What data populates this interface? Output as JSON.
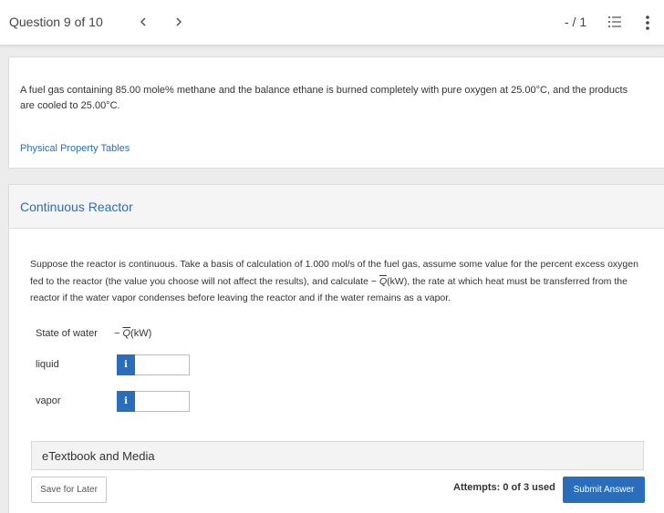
{
  "header": {
    "question_label": "Question 9 of 10",
    "prev_glyph": "<",
    "next_glyph": ">",
    "score": "- / 1"
  },
  "problem": {
    "text": "A fuel gas containing 85.00 mole% methane and the balance ethane is burned completely with pure oxygen at 25.00°C, and the products are cooled to 25.00°C.",
    "link_label": "Physical Property Tables"
  },
  "section": {
    "title": "Continuous Reactor",
    "prompt_before": "Suppose the reactor is continuous. Take a basis of calculation of 1.000 mol/s of the fuel gas, assume some value for the percent excess oxygen fed to the reactor (the value you choose will not affect the results), and calculate − ",
    "prompt_q": "Q",
    "prompt_after": "(kW), the rate at which heat must be transferred from the reactor if the water vapor condenses before leaving the reactor and if the water remains as a vapor."
  },
  "table": {
    "col_state": "State of water",
    "col_q_prefix": "− ",
    "col_q_symbol": "Q",
    "col_q_suffix": "(kW)",
    "rows": [
      {
        "label": "liquid",
        "value": ""
      },
      {
        "label": "vapor",
        "value": ""
      }
    ],
    "info_glyph": "i"
  },
  "media": {
    "label": "eTextbook and Media"
  },
  "footer": {
    "save_label": "Save for Later",
    "attempts": "Attempts: 0 of 3 used",
    "submit_label": "Submit Answer"
  },
  "colors": {
    "accent": "#2a6ebb"
  }
}
